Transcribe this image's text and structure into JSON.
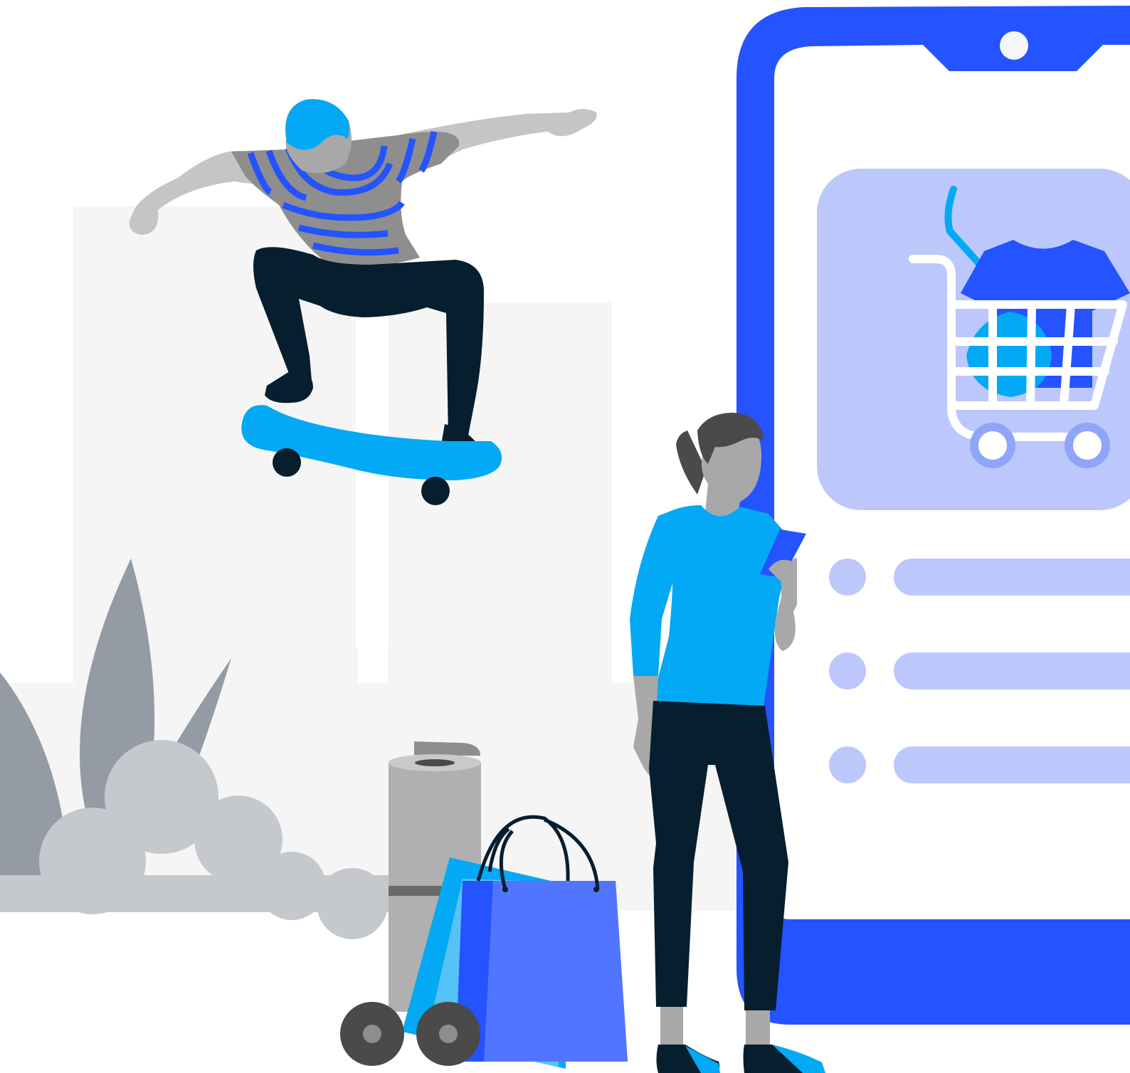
{
  "colors": {
    "phone_body": "#2453ff",
    "screen": "#ffffff",
    "card": "#bcc8fc",
    "cart_wheel": "#8fa5f7",
    "accent_cyan": "#03a9f4",
    "dark_navy": "#071e2e",
    "skin_gray": "#a8a8a8",
    "plant_gray": "#959ba5",
    "bush_gray": "#c5c8cc",
    "building_gray": "#f5f5f5",
    "hair_dark": "#4a4a4a"
  },
  "icons": {
    "cart": "shopping-cart-icon",
    "tshirt": "tshirt-icon",
    "notch_camera": "camera-dot-icon"
  },
  "phone": {
    "list_rows": 3
  }
}
